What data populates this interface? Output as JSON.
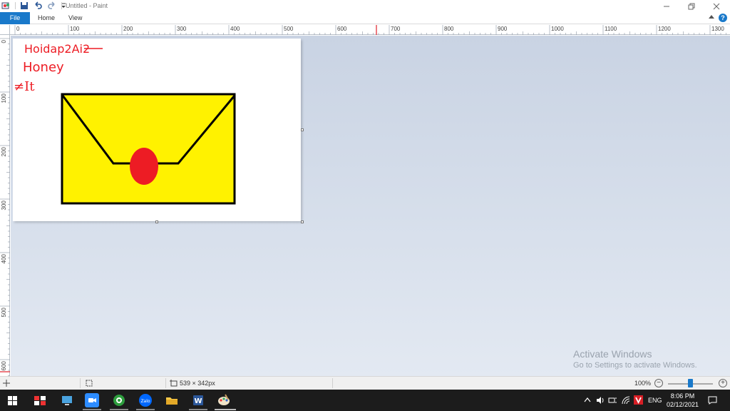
{
  "window": {
    "title": "Untitled - Paint",
    "controls": [
      "minimize",
      "restore",
      "close"
    ]
  },
  "ribbon": {
    "tabs": [
      "File",
      "Home",
      "View"
    ]
  },
  "ruler": {
    "horizontal_labels": [
      "0",
      "100",
      "200",
      "300",
      "400",
      "500",
      "600",
      "700",
      "800",
      "900",
      "1000",
      "1100",
      "1200",
      "1300"
    ],
    "vertical_labels": [
      "0",
      "100",
      "200",
      "300",
      "400",
      "500",
      "600"
    ]
  },
  "canvas": {
    "handwriting": [
      "Hoidap2Ai2",
      "Honey",
      "≠It"
    ]
  },
  "status": {
    "canvas_size": "539 × 342px",
    "zoom": "100%",
    "zoom_fraction": 0.5
  },
  "watermark": {
    "title": "Activate Windows",
    "subtitle": "Go to Settings to activate Windows."
  },
  "taskbar": {
    "apps": [
      "start-icon",
      "store-icon",
      "desktop-icon",
      "zoom-icon",
      "coccoc-icon",
      "zalo-icon",
      "file-explorer-icon",
      "word-icon",
      "paint-icon"
    ],
    "zalo_label": "Zalo",
    "word_label": "W",
    "language": "ENG",
    "time": "8:06 PM",
    "date": "02/12/2021"
  },
  "colors": {
    "accent": "#1979ca",
    "envelope_fill": "#fff200",
    "seal": "#ed1c24",
    "ink": "#ed1c24"
  }
}
